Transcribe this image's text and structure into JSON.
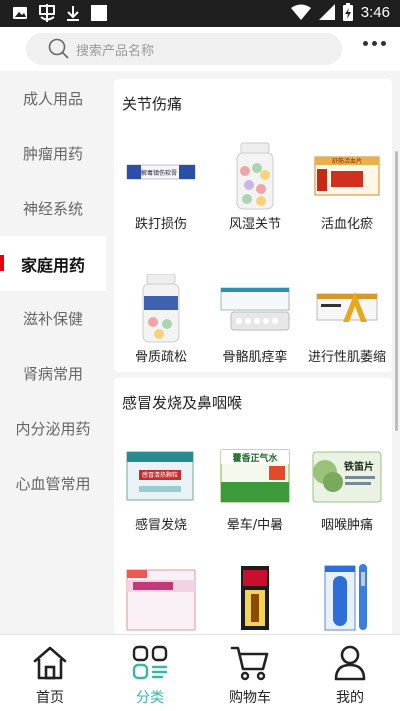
{
  "status": {
    "time": "3:46"
  },
  "search": {
    "placeholder": "搜索产品名称"
  },
  "sidebar": {
    "items": [
      {
        "label": "成人用品"
      },
      {
        "label": "肿瘤用药"
      },
      {
        "label": "神经系统"
      },
      {
        "label": "家庭用药"
      },
      {
        "label": "滋补保健"
      },
      {
        "label": "肾病常用"
      },
      {
        "label": "内分泌用药"
      },
      {
        "label": "心血管常用"
      }
    ],
    "active_index": 3
  },
  "sections": [
    {
      "title": "关节伤痛",
      "products": [
        {
          "label": "跌打损伤"
        },
        {
          "label": "风湿关节"
        },
        {
          "label": "活血化瘀"
        },
        {
          "label": "骨质疏松"
        },
        {
          "label": "骨骼肌痉挛"
        },
        {
          "label": "进行性肌萎缩"
        }
      ]
    },
    {
      "title": "感冒发烧及鼻咽喉",
      "products": [
        {
          "label": "感冒发烧"
        },
        {
          "label": "晕车/中暑"
        },
        {
          "label": "咽喉肿痛"
        },
        {
          "label": ""
        },
        {
          "label": ""
        },
        {
          "label": ""
        }
      ]
    }
  ],
  "package_text": {
    "p1": "解毒镇伤软膏",
    "p3": "舒筋活血片",
    "p7": "感冒清热颗粒",
    "p8": "藿香正气水",
    "p9": "铁笛片"
  },
  "tabbar": {
    "items": [
      {
        "label": "首页"
      },
      {
        "label": "分类"
      },
      {
        "label": "购物车"
      },
      {
        "label": "我的"
      }
    ],
    "active_index": 1
  },
  "colors": {
    "accent": "#3ab5a9",
    "active_marker": "#e60012"
  }
}
